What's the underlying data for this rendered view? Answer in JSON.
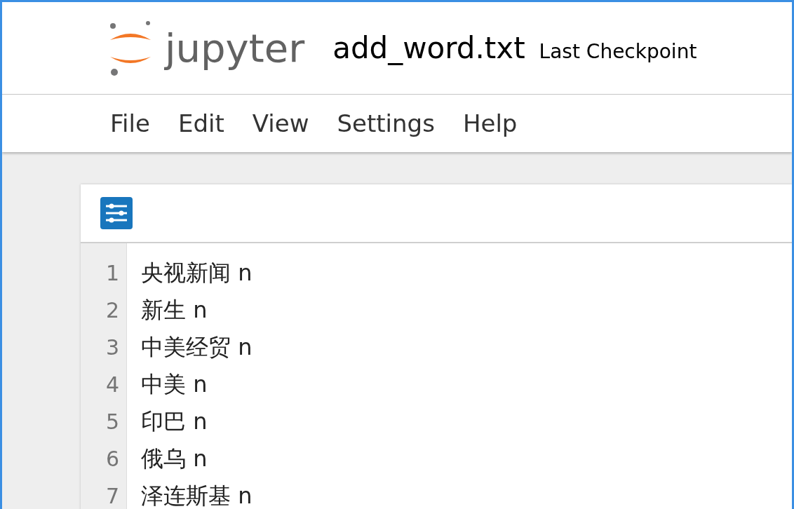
{
  "header": {
    "logo_text": "jupyter",
    "file_name": "add_word.txt",
    "checkpoint": "Last Checkpoint"
  },
  "menu": [
    "File",
    "Edit",
    "View",
    "Settings",
    "Help"
  ],
  "editor": {
    "lines": [
      {
        "number": "1",
        "text": "央视新闻 n"
      },
      {
        "number": "2",
        "text": "新生 n"
      },
      {
        "number": "3",
        "text": "中美经贸 n"
      },
      {
        "number": "4",
        "text": "中美 n"
      },
      {
        "number": "5",
        "text": "印巴 n"
      },
      {
        "number": "6",
        "text": "俄乌 n"
      },
      {
        "number": "7",
        "text": "泽连斯基 n"
      }
    ]
  }
}
